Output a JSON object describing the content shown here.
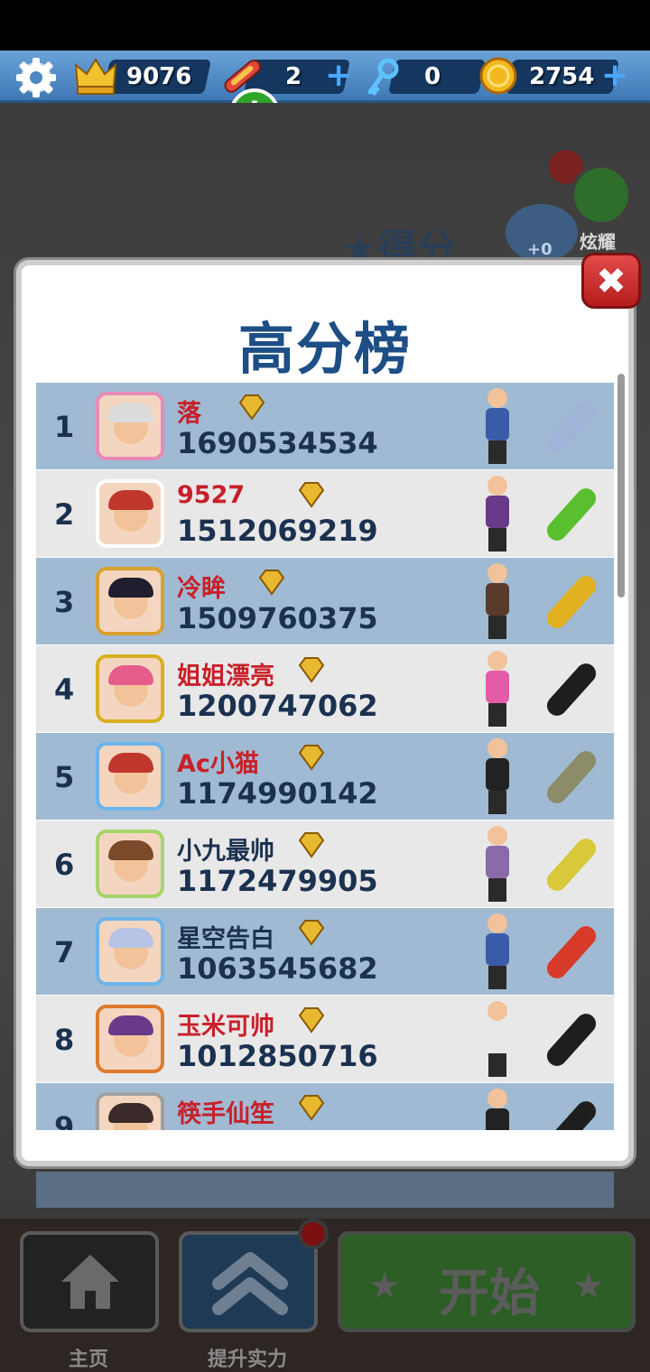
{
  "hud": {
    "crowns": "9076",
    "boards": "2",
    "keys": "0",
    "coins": "2754"
  },
  "background": {
    "title_partial": "★得分",
    "trophy_count": "+0",
    "share_label": "炫耀"
  },
  "panel": {
    "title": "高分榜",
    "close_symbol": "✖"
  },
  "leaderboard": [
    {
      "rank": "1",
      "name": "落",
      "score": "1690534534",
      "name_color": "#c8202a"
    },
    {
      "rank": "2",
      "name": "9527",
      "score": "1512069219",
      "name_color": "#c8202a"
    },
    {
      "rank": "3",
      "name": "冷眸",
      "score": "1509760375",
      "name_color": "#c8202a"
    },
    {
      "rank": "4",
      "name": "姐姐漂亮",
      "score": "1200747062",
      "name_color": "#c8202a"
    },
    {
      "rank": "5",
      "name": "Ac小猫",
      "score": "1174990142",
      "name_color": "#c8202a"
    },
    {
      "rank": "6",
      "name": "小九最帅",
      "score": "1172479905",
      "name_color": "#1b3150"
    },
    {
      "rank": "7",
      "name": "星空告白",
      "score": "1063545682",
      "name_color": "#1b3150"
    },
    {
      "rank": "8",
      "name": "玉米可帅",
      "score": "1012850716",
      "name_color": "#c8202a"
    },
    {
      "rank": "9",
      "name": "筷手仙笙",
      "score": "",
      "name_color": "#c8202a"
    }
  ],
  "bottom_nav": {
    "home_label": "主页",
    "upgrade_label": "提升实力",
    "start_label": "开始"
  },
  "colors": {
    "accent_blue": "#1d4e86",
    "row_blue": "#9fbad2",
    "row_gray": "#e8e8e8",
    "close_red": "#d63030"
  }
}
